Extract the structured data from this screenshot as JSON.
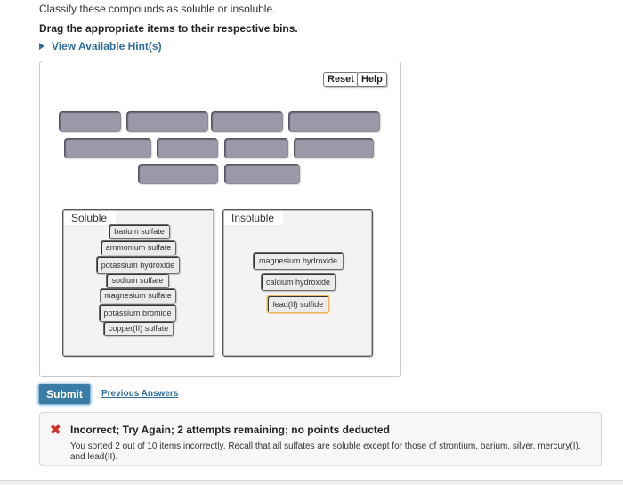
{
  "instructions": {
    "line1": "Classify these compounds as soluble or insoluble.",
    "line2": "Drag the appropriate items to their respective bins.",
    "hint_link": "View Available Hint(s)",
    "hint_icon": "triangle-right-icon"
  },
  "toolbar": {
    "reset_label": "Reset",
    "help_label": "Help"
  },
  "answer_slots": {
    "rows": [
      4,
      4,
      2
    ],
    "count": 10
  },
  "bins": [
    {
      "label": "Soluble",
      "items": [
        "barium sulfate",
        "ammonium sulfate",
        "potassium hydroxide",
        "sodium sulfate",
        "magnesium sulfate",
        "potassium bromide",
        "copper(II) sulfate"
      ]
    },
    {
      "label": "Insoluble",
      "items": [
        "magnesium hydroxide",
        "calcium hydroxide",
        "lead(II) sulfide"
      ],
      "selected_item": "lead(II) sulfide"
    }
  ],
  "actions": {
    "submit_label": "Submit",
    "previous_answers_label": "Previous Answers"
  },
  "feedback": {
    "icon": "x-icon",
    "icon_color": "#d0312d",
    "title": "Incorrect; Try Again; 2 attempts remaining; no points deducted",
    "message": "You sorted 2 out of 10 items incorrectly. Recall that all sulfates are soluble except for those of strontium, barium, silver, mercury(I), and lead(II)."
  },
  "colors": {
    "link": "#2f6e9a",
    "submit_bg": "#3a7ca5",
    "slot_fill": "#9b99a8",
    "selected_border": "#e8b65c"
  }
}
